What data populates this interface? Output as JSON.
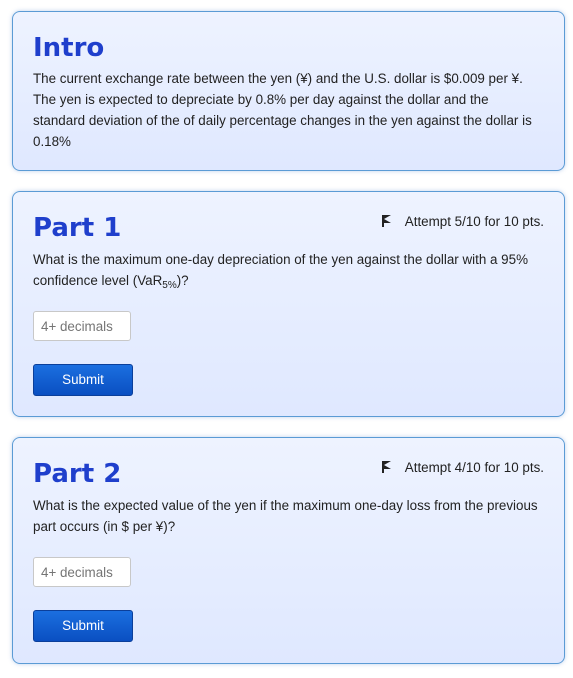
{
  "intro": {
    "title": "Intro",
    "text": "The current exchange rate between the yen (¥) and the U.S. dollar is $0.009 per ¥. The yen is expected to depreciate by 0.8% per day against the dollar and the standard deviation of the of daily percentage changes in the yen against the dollar is 0.18%"
  },
  "part1": {
    "title": "Part 1",
    "attempt": "Attempt 5/10 for 10 pts.",
    "question_pre": "What is the maximum one-day depreciation of the yen against the dollar with a 95% confidence level (VaR",
    "question_sub": "5%",
    "question_post": ")?",
    "input_placeholder": "4+ decimals",
    "submit_label": "Submit"
  },
  "part2": {
    "title": "Part 2",
    "attempt": "Attempt 4/10 for 10 pts.",
    "question": "What is the expected value of the yen if the maximum one-day loss from the previous part occurs (in $ per ¥)?",
    "input_placeholder": "4+ decimals",
    "submit_label": "Submit"
  },
  "icons": {
    "attempt_flag": "flag-icon"
  },
  "colors": {
    "title": "#1f3fcc",
    "button": "#1b6fe0",
    "card_border": "#5b9bd5"
  }
}
